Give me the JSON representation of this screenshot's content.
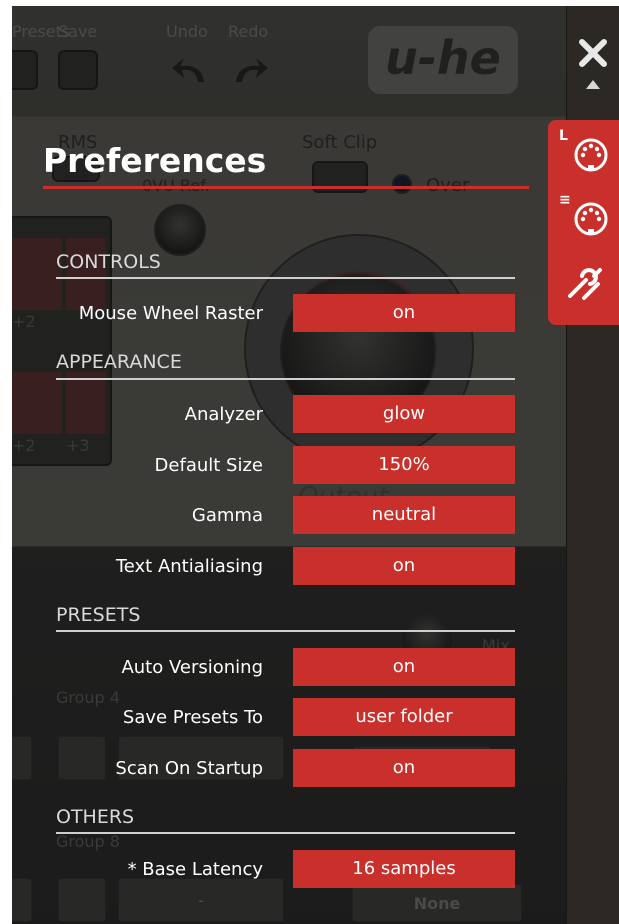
{
  "background": {
    "toolbar": {
      "presets_label": "Presets",
      "save_label": "Save",
      "undo_label": "Undo",
      "redo_label": "Redo"
    },
    "logo_text": "u-he",
    "rms_label": "RMS",
    "softclip_label": "Soft Clip",
    "over_label": "Over",
    "vu_ref_label": "0VU Ref.",
    "meter_plus2": "+2",
    "meter_plus3": "+3",
    "output_label": "Output",
    "group4_label": "Group 4",
    "group8_label": "Group 8",
    "mix_label": "Mix",
    "none_label": "None",
    "dash_label": "-"
  },
  "close": {
    "icon": "close-icon"
  },
  "tabs": [
    {
      "letter": "L",
      "icon": "midi-icon"
    },
    {
      "letter": "≡",
      "icon": "midi-icon"
    },
    {
      "letter": "",
      "icon": "tools-icon",
      "active": true
    }
  ],
  "preferences": {
    "title": "Preferences",
    "sections": {
      "controls": "CONTROLS",
      "appearance": "APPEARANCE",
      "presets": "PRESETS",
      "others": "OTHERS"
    },
    "rows": {
      "mouse_wheel_raster": {
        "label": "Mouse Wheel Raster",
        "value": "on"
      },
      "analyzer": {
        "label": "Analyzer",
        "value": "glow"
      },
      "default_size": {
        "label": "Default Size",
        "value": "150%"
      },
      "gamma": {
        "label": "Gamma",
        "value": "neutral"
      },
      "text_antialiasing": {
        "label": "Text Antialiasing",
        "value": "on"
      },
      "auto_versioning": {
        "label": "Auto Versioning",
        "value": "on"
      },
      "save_presets_to": {
        "label": "Save Presets To",
        "value": "user folder"
      },
      "scan_on_startup": {
        "label": "Scan On Startup",
        "value": "on"
      },
      "base_latency": {
        "label": "* Base Latency",
        "value": "16 samples"
      }
    }
  },
  "colors": {
    "accent": "#c9302c",
    "panel_text": "#ffffff",
    "rule": "#cfcfcf"
  }
}
